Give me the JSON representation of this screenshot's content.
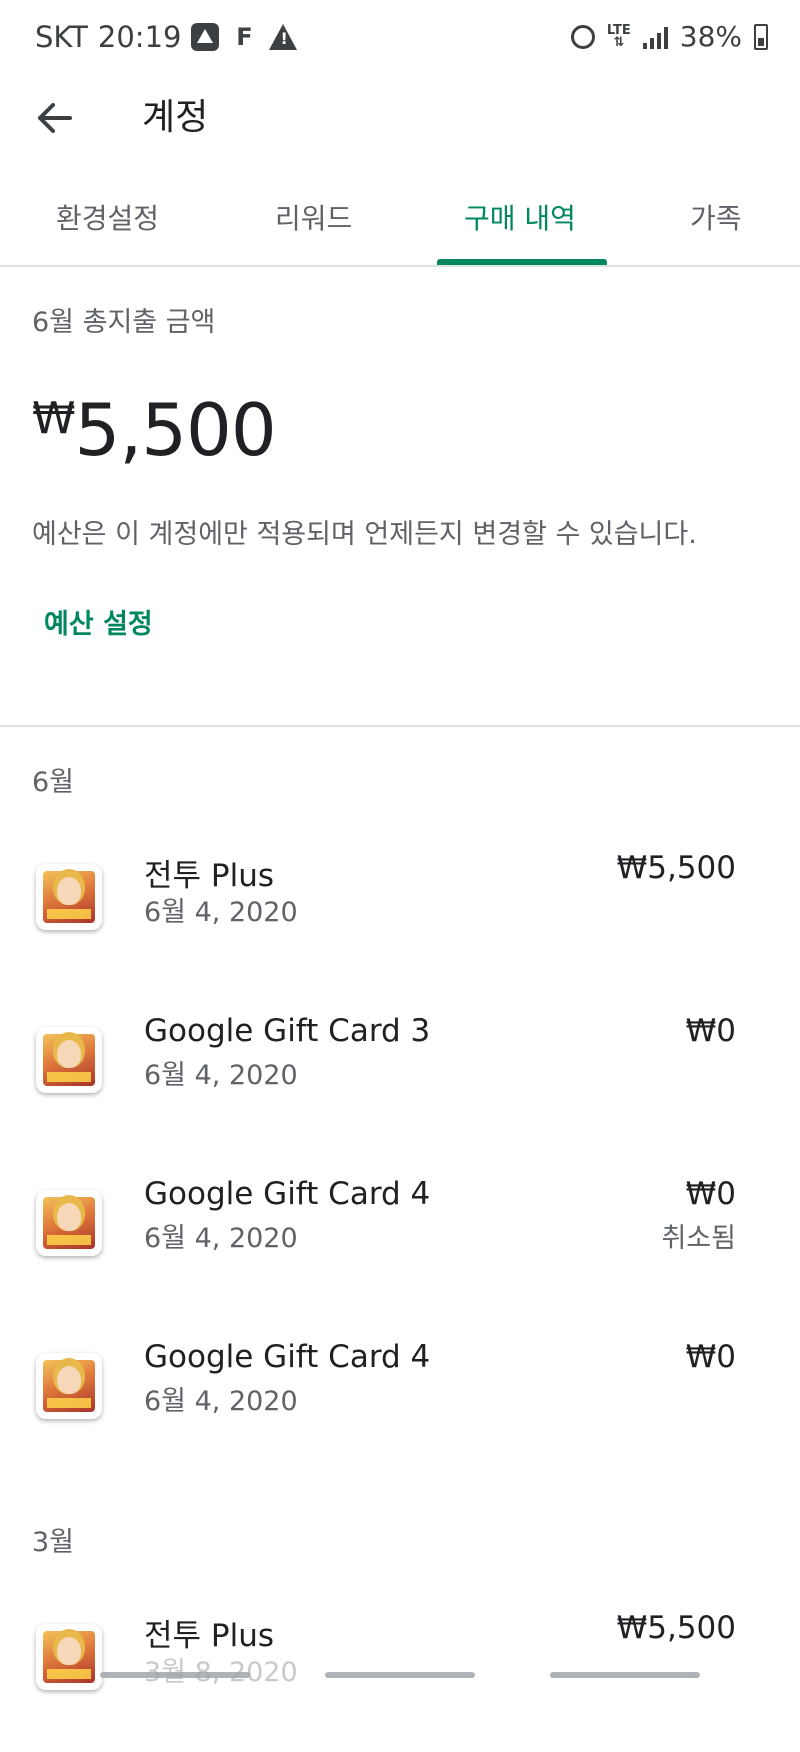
{
  "status_bar": {
    "carrier": "SKT",
    "time": "20:19",
    "network_type": "LTE",
    "battery": "38%",
    "icons": [
      "app-notification-icon",
      "f-notification-icon",
      "warning-icon",
      "alarm-icon",
      "lte-icon",
      "signal-icon",
      "battery-charging-icon"
    ]
  },
  "app_bar": {
    "title": "계정",
    "back_icon": "back-arrow-icon"
  },
  "tabs": [
    {
      "label": "환경설정",
      "active": false
    },
    {
      "label": "리워드",
      "active": false
    },
    {
      "label": "구매 내역",
      "active": true
    },
    {
      "label": "가족",
      "active": false
    }
  ],
  "spending": {
    "label": "6월 총지출 금액",
    "currency": "₩",
    "amount": "5,500",
    "note": "예산은 이 계정에만 적용되며 언제든지 변경할 수 있습니다.",
    "budget_button": "예산 설정"
  },
  "groups": [
    {
      "month": "6월",
      "items": [
        {
          "name": "전투 Plus",
          "date": "6월 4, 2020",
          "price": "₩5,500",
          "status": ""
        },
        {
          "name": "Google Gift Card 3",
          "date": "6월 4, 2020",
          "price": "₩0",
          "status": ""
        },
        {
          "name": "Google Gift Card 4",
          "date": "6월 4, 2020",
          "price": "₩0",
          "status": "취소됨"
        },
        {
          "name": "Google Gift Card 4",
          "date": "6월 4, 2020",
          "price": "₩0",
          "status": ""
        }
      ]
    },
    {
      "month": "3월",
      "items": [
        {
          "name": "전투 Plus",
          "date": "3월 8, 2020",
          "price": "₩5,500",
          "status": ""
        }
      ]
    }
  ],
  "colors": {
    "accent": "#01875f",
    "text_primary": "#202124",
    "text_secondary": "#5f6368",
    "divider": "#e0e0e0"
  }
}
